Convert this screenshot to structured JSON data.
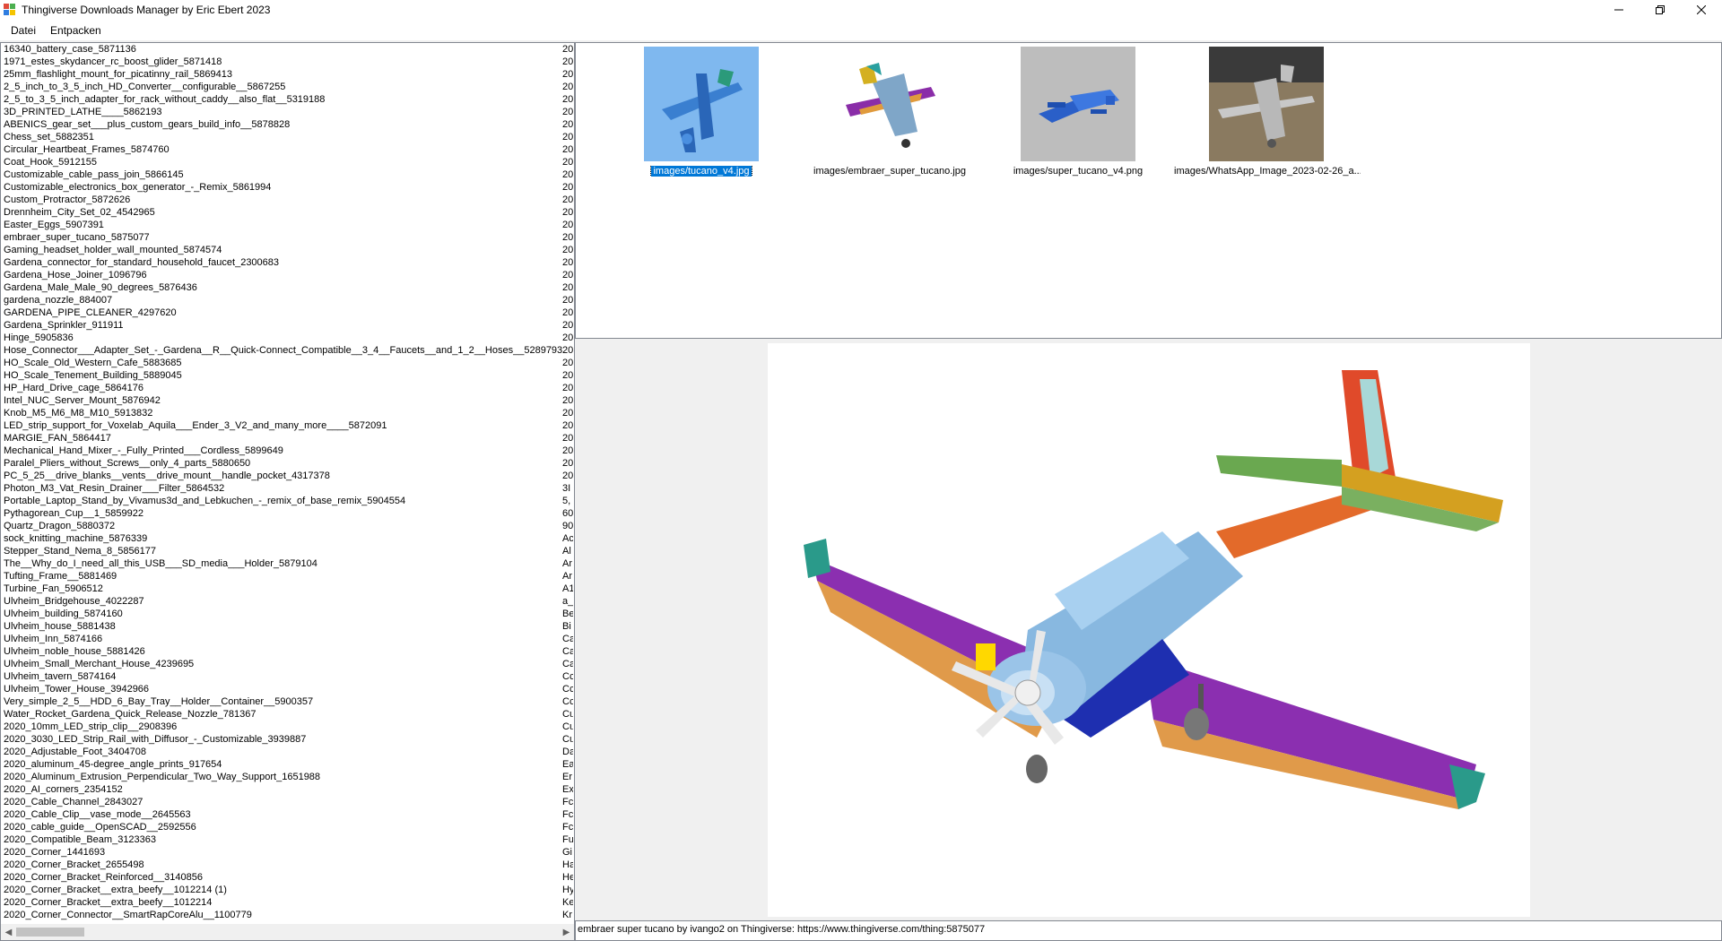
{
  "window": {
    "title": "Thingiverse Downloads Manager by Eric Ebert 2023",
    "controls": [
      "minimize-icon",
      "restore-icon",
      "close-icon"
    ]
  },
  "menu": {
    "items": [
      {
        "label": "Datei"
      },
      {
        "label": "Entpacken"
      }
    ]
  },
  "list": {
    "items": [
      {
        "name": "16340_battery_case_5871136",
        "col2": "20"
      },
      {
        "name": "1971_estes_skydancer_rc_boost_glider_5871418",
        "col2": "20"
      },
      {
        "name": "25mm_flashlight_mount_for_picatinny_rail_5869413",
        "col2": "20"
      },
      {
        "name": "2_5_inch_to_3_5_inch_HD_Converter__configurable__5867255",
        "col2": "20"
      },
      {
        "name": "2_5_to_3_5_inch_adapter_for_rack_without_caddy__also_flat__5319188",
        "col2": "20"
      },
      {
        "name": "3D_PRINTED_LATHE____5862193",
        "col2": "20"
      },
      {
        "name": "ABENICS_gear_set___plus_custom_gears_build_info__5878828",
        "col2": "20"
      },
      {
        "name": "Chess_set_5882351",
        "col2": "20"
      },
      {
        "name": "Circular_Heartbeat_Frames_5874760",
        "col2": "20"
      },
      {
        "name": "Coat_Hook_5912155",
        "col2": "20"
      },
      {
        "name": "Customizable_cable_pass_join_5866145",
        "col2": "20"
      },
      {
        "name": "Customizable_electronics_box_generator_-_Remix_5861994",
        "col2": "20"
      },
      {
        "name": "Custom_Protractor_5872626",
        "col2": "20"
      },
      {
        "name": "Drennheim_City_Set_02_4542965",
        "col2": "20"
      },
      {
        "name": "Easter_Eggs_5907391",
        "col2": "20"
      },
      {
        "name": "embraer_super_tucano_5875077",
        "col2": "20"
      },
      {
        "name": "Gaming_headset_holder_wall_mounted_5874574",
        "col2": "20"
      },
      {
        "name": "Gardena_connector_for_standard_household_faucet_2300683",
        "col2": "20"
      },
      {
        "name": "Gardena_Hose_Joiner_1096796",
        "col2": "20"
      },
      {
        "name": "Gardena_Male_Male_90_degrees_5876436",
        "col2": "20"
      },
      {
        "name": "gardena_nozzle_884007",
        "col2": "20"
      },
      {
        "name": "GARDENA_PIPE_CLEANER_4297620",
        "col2": "20"
      },
      {
        "name": "Gardena_Sprinkler_911911",
        "col2": "20"
      },
      {
        "name": "Hinge_5905836",
        "col2": "20"
      },
      {
        "name": "Hose_Connector___Adapter_Set_-_Gardena__R__Quick-Connect_Compatible__3_4__Faucets__and_1_2__Hoses__5289793",
        "col2": "20"
      },
      {
        "name": "HO_Scale_Old_Western_Cafe_5883685",
        "col2": "20"
      },
      {
        "name": "HO_Scale_Tenement_Building_5889045",
        "col2": "20"
      },
      {
        "name": "HP_Hard_Drive_cage_5864176",
        "col2": "20"
      },
      {
        "name": "Intel_NUC_Server_Mount_5876942",
        "col2": "20"
      },
      {
        "name": "Knob_M5_M6_M8_M10_5913832",
        "col2": "20"
      },
      {
        "name": "LED_strip_support_for_Voxelab_Aquila___Ender_3_V2_and_many_more____5872091",
        "col2": "20"
      },
      {
        "name": "MARGIE_FAN_5864417",
        "col2": "20"
      },
      {
        "name": "Mechanical_Hand_Mixer_-_Fully_Printed___Cordless_5899649",
        "col2": "20"
      },
      {
        "name": "Paralel_Pliers_without_Screws__only_4_parts_5880650",
        "col2": "20"
      },
      {
        "name": "PC_5_25__drive_blanks__vents__drive_mount__handle_pocket_4317378",
        "col2": "20"
      },
      {
        "name": "Photon_M3_Vat_Resin_Drainer___Filter_5864532",
        "col2": "3I"
      },
      {
        "name": "Portable_Laptop_Stand_by_Vivamus3d_and_Lebkuchen_-_remix_of_base_remix_5904554",
        "col2": "5,"
      },
      {
        "name": "Pythagorean_Cup__1_5859922",
        "col2": "60"
      },
      {
        "name": "Quartz_Dragon_5880372",
        "col2": "90"
      },
      {
        "name": "sock_knitting_machine_5876339",
        "col2": "Ac"
      },
      {
        "name": "Stepper_Stand_Nema_8_5856177",
        "col2": "Al"
      },
      {
        "name": "The__Why_do_I_need_all_this_USB___SD_media___Holder_5879104",
        "col2": "Ar"
      },
      {
        "name": "Tufting_Frame__5881469",
        "col2": "Ar"
      },
      {
        "name": "Turbine_Fan_5906512",
        "col2": "A1"
      },
      {
        "name": "Ulvheim_Bridgehouse_4022287",
        "col2": "a_"
      },
      {
        "name": "Ulvheim_building_5874160",
        "col2": "Be"
      },
      {
        "name": "Ulvheim_house_5881438",
        "col2": "Bi"
      },
      {
        "name": "Ulvheim_Inn_5874166",
        "col2": "Ca"
      },
      {
        "name": "Ulvheim_noble_house_5881426",
        "col2": "Ca"
      },
      {
        "name": "Ulvheim_Small_Merchant_House_4239695",
        "col2": "Ca"
      },
      {
        "name": "Ulvheim_tavern_5874164",
        "col2": "Cc"
      },
      {
        "name": "Ulvheim_Tower_House_3942966",
        "col2": "Cc"
      },
      {
        "name": "Very_simple_2_5__HDD_6_Bay_Tray__Holder__Container__5900357",
        "col2": "Cc"
      },
      {
        "name": "Water_Rocket_Gardena_Quick_Release_Nozzle_781367",
        "col2": "Cu"
      },
      {
        "name": "2020_10mm_LED_strip_clip__2908396",
        "col2": "Cu"
      },
      {
        "name": "2020_3030_LED_Strip_Rail_with_Diffusor_-_Customizable_3939887",
        "col2": "Cu"
      },
      {
        "name": "2020_Adjustable_Foot_3404708",
        "col2": "Da"
      },
      {
        "name": "2020_aluminum_45-degree_angle_prints_917654",
        "col2": "Ea"
      },
      {
        "name": "2020_Aluminum_Extrusion_Perpendicular_Two_Way_Support_1651988",
        "col2": "Er"
      },
      {
        "name": "2020_AI_corners_2354152",
        "col2": "Ex"
      },
      {
        "name": "2020_Cable_Channel_2843027",
        "col2": "Fc"
      },
      {
        "name": "2020_Cable_Clip__vase_mode__2645563",
        "col2": "Fc"
      },
      {
        "name": "2020_cable_guide__OpenSCAD__2592556",
        "col2": "Fc"
      },
      {
        "name": "2020_Compatible_Beam_3123363",
        "col2": "Fu"
      },
      {
        "name": "2020_Corner_1441693",
        "col2": "Gi"
      },
      {
        "name": "2020_Corner_Bracket_2655498",
        "col2": "Ha"
      },
      {
        "name": "2020_Corner_Bracket_Reinforced__3140856",
        "col2": "He"
      },
      {
        "name": "2020_Corner_Bracket__extra_beefy__1012214 (1)",
        "col2": "Hy"
      },
      {
        "name": "2020_Corner_Bracket__extra_beefy__1012214",
        "col2": "Ke"
      },
      {
        "name": "2020_Corner_Connector__SmartRapCoreAlu__1100779",
        "col2": "Kr"
      }
    ]
  },
  "gallery": {
    "items": [
      {
        "caption": "images/tucano_v4.jpg",
        "selected": true
      },
      {
        "caption": "images/embraer_super_tucano.jpg",
        "selected": false
      },
      {
        "caption": "images/super_tucano_v4.png",
        "selected": false
      },
      {
        "caption": "images/WhatsApp_Image_2023-02-26_a...",
        "selected": false
      }
    ]
  },
  "status": {
    "text": "embraer super tucano by ivango2 on Thingiverse: https://www.thingiverse.com/thing:5875077"
  },
  "colors": {
    "selection": "#0078d7",
    "border": "#828790",
    "background": "#f0f0f0"
  }
}
